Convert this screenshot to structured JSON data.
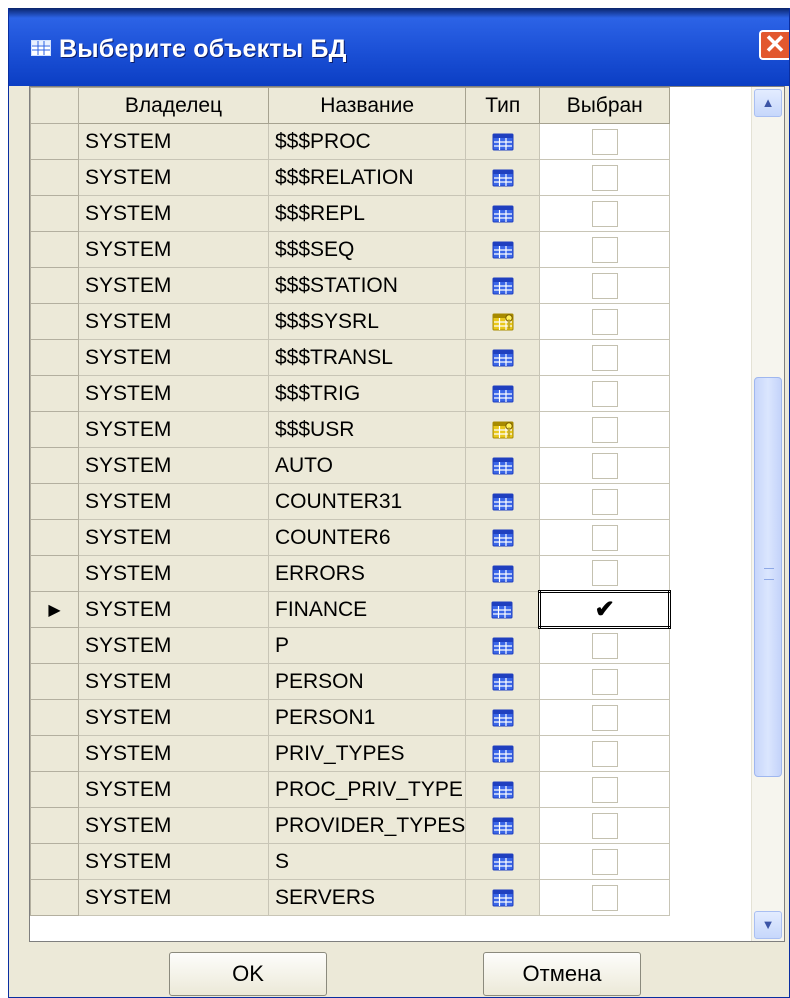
{
  "window": {
    "title": "Выберите объекты БД",
    "close_glyph": "✕",
    "accent": "#2c63e6"
  },
  "grid": {
    "columns": [
      "Владелец",
      "Название",
      "Тип",
      "Выбран"
    ],
    "current_row_marker": "▶",
    "rows": [
      {
        "owner": "SYSTEM",
        "name": "$$$PROC",
        "type_icon": "table-icon",
        "selected": false
      },
      {
        "owner": "SYSTEM",
        "name": "$$$RELATION",
        "type_icon": "table-icon",
        "selected": false
      },
      {
        "owner": "SYSTEM",
        "name": "$$$REPL",
        "type_icon": "table-icon",
        "selected": false
      },
      {
        "owner": "SYSTEM",
        "name": "$$$SEQ",
        "type_icon": "table-icon",
        "selected": false
      },
      {
        "owner": "SYSTEM",
        "name": "$$$STATION",
        "type_icon": "table-icon",
        "selected": false
      },
      {
        "owner": "SYSTEM",
        "name": "$$$SYSRL",
        "type_icon": "system-table-key-icon",
        "selected": false
      },
      {
        "owner": "SYSTEM",
        "name": "$$$TRANSL",
        "type_icon": "table-icon",
        "selected": false
      },
      {
        "owner": "SYSTEM",
        "name": "$$$TRIG",
        "type_icon": "table-icon",
        "selected": false
      },
      {
        "owner": "SYSTEM",
        "name": "$$$USR",
        "type_icon": "system-table-key-icon",
        "selected": false
      },
      {
        "owner": "SYSTEM",
        "name": "AUTO",
        "type_icon": "table-icon",
        "selected": false
      },
      {
        "owner": "SYSTEM",
        "name": "COUNTER31",
        "type_icon": "table-icon",
        "selected": false
      },
      {
        "owner": "SYSTEM",
        "name": "COUNTER6",
        "type_icon": "table-icon",
        "selected": false
      },
      {
        "owner": "SYSTEM",
        "name": "ERRORS",
        "type_icon": "table-icon",
        "selected": false
      },
      {
        "owner": "SYSTEM",
        "name": "FINANCE",
        "type_icon": "table-icon",
        "selected": true,
        "current": true
      },
      {
        "owner": "SYSTEM",
        "name": "P",
        "type_icon": "table-icon",
        "selected": false
      },
      {
        "owner": "SYSTEM",
        "name": "PERSON",
        "type_icon": "table-icon",
        "selected": false
      },
      {
        "owner": "SYSTEM",
        "name": "PERSON1",
        "type_icon": "table-icon",
        "selected": false
      },
      {
        "owner": "SYSTEM",
        "name": "PRIV_TYPES",
        "type_icon": "table-icon",
        "selected": false
      },
      {
        "owner": "SYSTEM",
        "name": "PROC_PRIV_TYPE",
        "type_icon": "table-icon",
        "selected": false
      },
      {
        "owner": "SYSTEM",
        "name": "PROVIDER_TYPES",
        "type_icon": "table-icon",
        "selected": false
      },
      {
        "owner": "SYSTEM",
        "name": "S",
        "type_icon": "table-icon",
        "selected": false
      },
      {
        "owner": "SYSTEM",
        "name": "SERVERS",
        "type_icon": "table-icon",
        "selected": false
      }
    ]
  },
  "scrollbar": {
    "up_glyph": "▲",
    "down_glyph": "▼"
  },
  "buttons": {
    "ok": "OK",
    "cancel": "Отмена"
  }
}
